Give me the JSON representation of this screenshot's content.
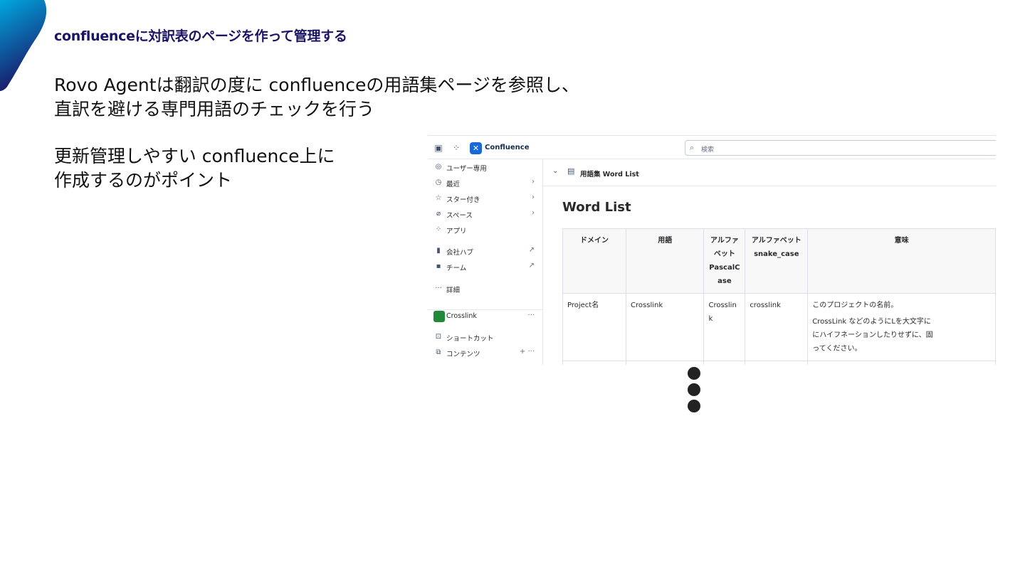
{
  "slide": {
    "title": "confluenceに対訳表のページを作って管理する",
    "intro_lines": [
      "Rovo Agentは翻訳の度に confluenceの用語集ページを参照し、",
      "直訳を避ける専門用語のチェックを行う"
    ],
    "point_lines": [
      "更新管理しやすい confluence上に",
      "作成するのがポイント"
    ],
    "colors": {
      "title": "#1b1464",
      "accent_gradient": [
        "#00a8e0",
        "#1b1464"
      ]
    }
  },
  "confluence": {
    "app_name": "Confluence",
    "search_placeholder": "検索",
    "sidebar": {
      "items": [
        {
          "label": "ユーザー専用",
          "icon": "user-circle-icon"
        },
        {
          "label": "最近",
          "icon": "clock-icon",
          "chevron": "›"
        },
        {
          "label": "スター付き",
          "icon": "star-icon",
          "chevron": "›"
        },
        {
          "label": "スペース",
          "icon": "spaces-icon",
          "chevron": "›"
        },
        {
          "label": "アプリ",
          "icon": "apps-grid-icon"
        },
        {
          "label": "会社ハブ",
          "icon": "company-hub-icon",
          "external": "↗"
        },
        {
          "label": "チーム",
          "icon": "team-icon",
          "external": "↗"
        },
        {
          "label": "詳細",
          "icon": "more-dots-icon"
        }
      ],
      "space": {
        "name": "Crosslink",
        "more": "···"
      },
      "space_items": [
        {
          "label": "ショートカット",
          "icon": "shortcut-icon"
        },
        {
          "label": "コンテンツ",
          "icon": "content-icon",
          "actions": "+ ···"
        }
      ]
    },
    "breadcrumb": "用語集 Word List",
    "page_title": "Word List",
    "table": {
      "headers": [
        "ドメイン",
        "用語",
        "アルファベットPascalCase",
        "アルファベット snake_case",
        "意味"
      ],
      "header_lines": [
        [
          "ドメイン"
        ],
        [
          "用語"
        ],
        [
          "アルファ",
          "ベット",
          "PascalC",
          "ase"
        ],
        [
          "アルファベット",
          "snake_case"
        ],
        [
          "意味"
        ]
      ],
      "rows": [
        {
          "domain": "Project名",
          "term": "Crosslink",
          "pascal_lines": [
            "Crosslin",
            "k"
          ],
          "snake": "crosslink",
          "meaning_lines": [
            "このプロジェクトの名前。",
            "CrossLink などのようにLを大文字に",
            "にハイフネーションしたりせずに、固",
            "ってください。"
          ]
        }
      ]
    }
  }
}
